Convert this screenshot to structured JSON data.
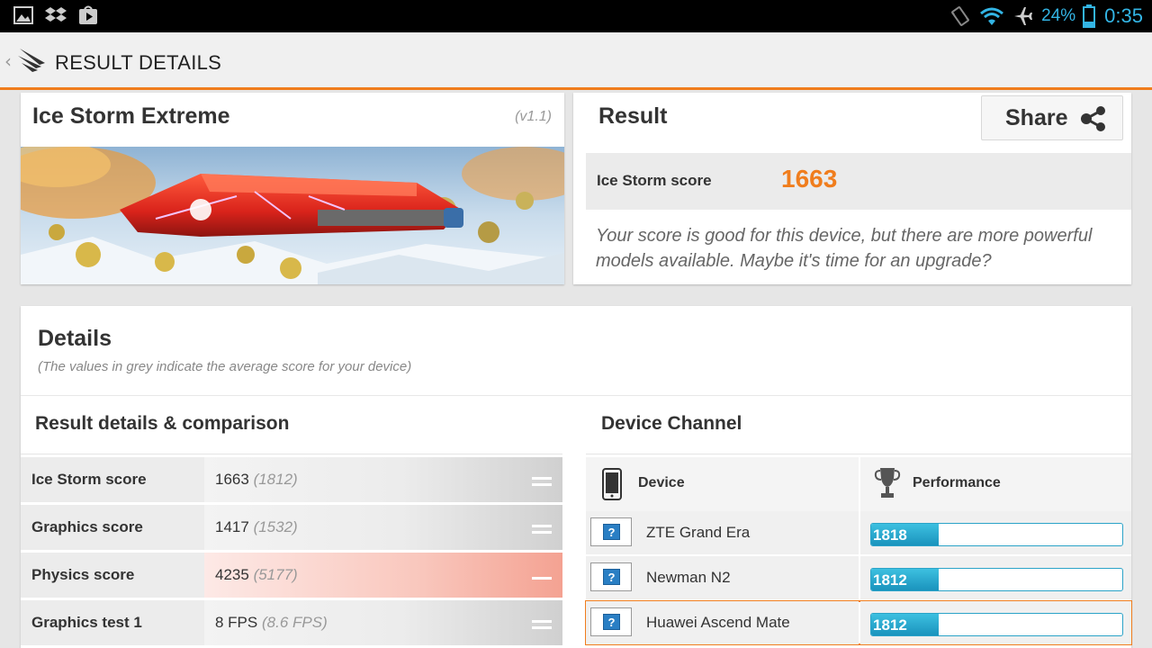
{
  "statusbar": {
    "battery": "24%",
    "time": "0:35"
  },
  "header": {
    "title": "RESULT DETAILS"
  },
  "benchmark": {
    "name": "Ice Storm Extreme",
    "version": "(v1.1)"
  },
  "result": {
    "title": "Result",
    "share_label": "Share",
    "score_label": "Ice Storm score",
    "score": "1663",
    "message": "Your score is good for this device, but there are more powerful models available. Maybe it's time for an upgrade?"
  },
  "details": {
    "title": "Details",
    "note": "(The values in grey indicate the average score for your device)",
    "comparison_title": "Result details & comparison",
    "rows": [
      {
        "label": "Ice Storm score",
        "value": "1663",
        "avg": "(1812)",
        "status": "equal"
      },
      {
        "label": "Graphics score",
        "value": "1417",
        "avg": "(1532)",
        "status": "equal"
      },
      {
        "label": "Physics score",
        "value": "4235",
        "avg": "(5177)",
        "status": "below"
      },
      {
        "label": "Graphics test 1",
        "value": "8 FPS",
        "avg": "(8.6 FPS)",
        "status": "equal"
      }
    ]
  },
  "channel": {
    "title": "Device Channel",
    "col_device": "Device",
    "col_performance": "Performance",
    "devices": [
      {
        "name": "ZTE Grand Era",
        "score": "1818",
        "fill": 0.27,
        "selected": false
      },
      {
        "name": "Newman N2",
        "score": "1812",
        "fill": 0.27,
        "selected": false
      },
      {
        "name": "Huawei Ascend Mate",
        "score": "1812",
        "fill": 0.27,
        "selected": true
      }
    ]
  },
  "colors": {
    "accent": "#f07d1d",
    "bar": "#1a93bd",
    "statusbar_text": "#33b5e5"
  }
}
